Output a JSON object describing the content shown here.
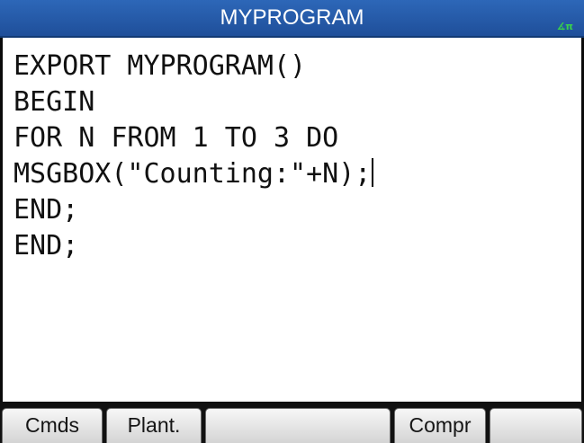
{
  "app": {
    "title": "MYPROGRAM",
    "status_icon": "angle-pi-icon",
    "status_icon_glyph": "∡π",
    "accent_color": "#1f4f9a",
    "status_color": "#39d24a"
  },
  "editor": {
    "lines": [
      "EXPORT MYPROGRAM()",
      "BEGIN",
      "FOR N FROM 1 TO 3 DO",
      "MSGBOX(\"Counting:\"+N);",
      "END;",
      "END;"
    ]
  },
  "softkeys": [
    "Cmds",
    "Plant.",
    "",
    "Compr",
    ""
  ]
}
